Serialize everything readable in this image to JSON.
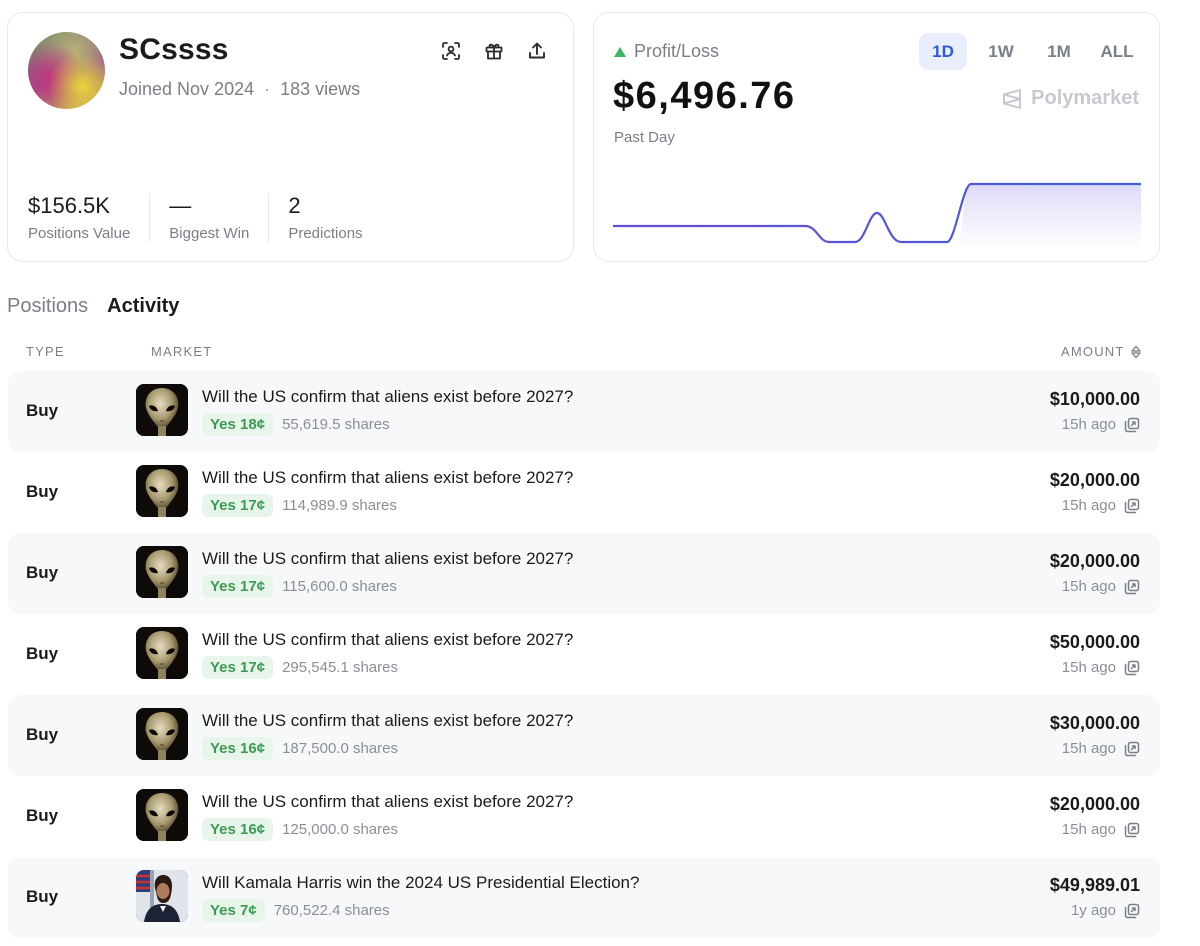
{
  "profile": {
    "username": "SCssss",
    "joined": "Joined Nov 2024",
    "separator": "·",
    "views": "183 views",
    "stats": [
      {
        "value": "$156.5K",
        "label": "Positions Value"
      },
      {
        "value": "—",
        "label": "Biggest Win"
      },
      {
        "value": "2",
        "label": "Predictions"
      }
    ]
  },
  "pnl": {
    "label": "Profit/Loss",
    "trend": "up",
    "value": "$6,496.76",
    "period_label": "Past Day",
    "brand": "Polymarket",
    "ranges": [
      "1D",
      "1W",
      "1M",
      "ALL"
    ],
    "active_range": "1D"
  },
  "tabs": {
    "positions": "Positions",
    "activity": "Activity",
    "active": "Activity"
  },
  "table": {
    "headers": {
      "type": "TYPE",
      "market": "MARKET",
      "amount": "AMOUNT"
    },
    "rows": [
      {
        "type": "Buy",
        "title": "Will the US confirm that aliens exist before 2027?",
        "outcome": "Yes 18¢",
        "shares": "55,619.5 shares",
        "amount": "$10,000.00",
        "time": "15h ago",
        "thumb": "alien"
      },
      {
        "type": "Buy",
        "title": "Will the US confirm that aliens exist before 2027?",
        "outcome": "Yes 17¢",
        "shares": "114,989.9 shares",
        "amount": "$20,000.00",
        "time": "15h ago",
        "thumb": "alien"
      },
      {
        "type": "Buy",
        "title": "Will the US confirm that aliens exist before 2027?",
        "outcome": "Yes 17¢",
        "shares": "115,600.0 shares",
        "amount": "$20,000.00",
        "time": "15h ago",
        "thumb": "alien"
      },
      {
        "type": "Buy",
        "title": "Will the US confirm that aliens exist before 2027?",
        "outcome": "Yes 17¢",
        "shares": "295,545.1 shares",
        "amount": "$50,000.00",
        "time": "15h ago",
        "thumb": "alien"
      },
      {
        "type": "Buy",
        "title": "Will the US confirm that aliens exist before 2027?",
        "outcome": "Yes 16¢",
        "shares": "187,500.0 shares",
        "amount": "$30,000.00",
        "time": "15h ago",
        "thumb": "alien"
      },
      {
        "type": "Buy",
        "title": "Will the US confirm that aliens exist before 2027?",
        "outcome": "Yes 16¢",
        "shares": "125,000.0 shares",
        "amount": "$20,000.00",
        "time": "15h ago",
        "thumb": "alien"
      },
      {
        "type": "Buy",
        "title": "Will Kamala Harris win the 2024 US Presidential Election?",
        "outcome": "Yes 7¢",
        "shares": "760,522.4 shares",
        "amount": "$49,989.01",
        "time": "1y ago",
        "thumb": "candidate"
      }
    ]
  },
  "icons": {
    "profile_actions": [
      "scan-icon",
      "gift-icon",
      "share-icon"
    ],
    "trend": "triangle-up-icon",
    "sort": "sort-icon",
    "row_link": "external-link-icon"
  },
  "colors": {
    "accent": "#2d5ae0",
    "chart_line": "#5b4ad6",
    "positive": "#3c9a52",
    "positive_bg": "#e7f5ea"
  }
}
